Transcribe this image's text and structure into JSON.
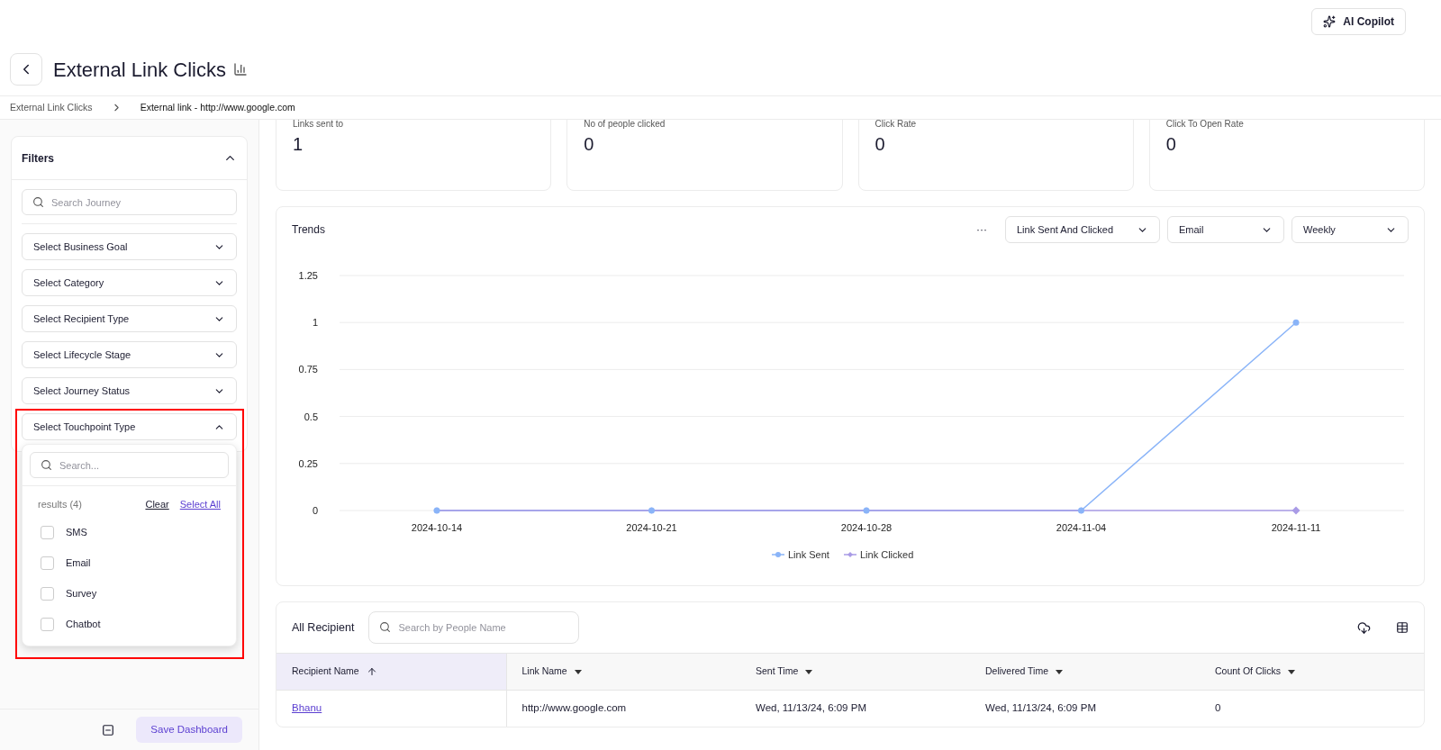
{
  "header": {
    "copilot_button": "AI Copilot",
    "title": "External Link Clicks"
  },
  "breadcrumb": [
    {
      "label": "External Link Clicks",
      "current": false
    },
    {
      "label": "External link - http://www.google.com",
      "current": true
    }
  ],
  "filters": {
    "title": "Filters",
    "expanded": true,
    "search_placeholder": "Search Journey",
    "dropdowns": [
      {
        "label": "Select Business Goal",
        "expanded": false
      },
      {
        "label": "Select Category",
        "expanded": false
      },
      {
        "label": "Select Recipient Type",
        "expanded": false
      },
      {
        "label": "Select Lifecycle Stage",
        "expanded": false
      },
      {
        "label": "Select Journey Status",
        "expanded": false
      },
      {
        "label": "Select Touchpoint Type",
        "expanded": true
      }
    ],
    "popup": {
      "search_placeholder": "Search...",
      "results": "results (4)",
      "clear": "Clear",
      "select_all": "Select All",
      "options": [
        {
          "label": "SMS",
          "checked": false
        },
        {
          "label": "Email",
          "checked": false
        },
        {
          "label": "Survey",
          "checked": false
        },
        {
          "label": "Chatbot",
          "checked": false
        }
      ]
    }
  },
  "save_button": "Save Dashboard",
  "stats": [
    {
      "label": "Links sent to",
      "value": "1"
    },
    {
      "label": "No of people clicked",
      "value": "0"
    },
    {
      "label": "Click Rate",
      "value": "0"
    },
    {
      "label": "Click To Open Rate",
      "value": "0"
    }
  ],
  "trends": {
    "title": "Trends",
    "more": "···",
    "selects": [
      "Link Sent And Clicked",
      "Email",
      "Weekly"
    ],
    "chart_data": {
      "type": "line",
      "x": [
        "2024-10-14",
        "2024-10-21",
        "2024-10-28",
        "2024-11-04",
        "2024-11-11"
      ],
      "series": [
        {
          "name": "Link Sent",
          "color": "#8ab4f8",
          "marker": "circle",
          "values": [
            0,
            0,
            0,
            0,
            1
          ]
        },
        {
          "name": "Link Clicked",
          "color": "#a99be6",
          "marker": "diamond",
          "values": [
            0,
            0,
            0,
            0,
            0
          ]
        }
      ],
      "grid": true,
      "legend": true,
      "ylim": [
        0,
        1.25
      ],
      "yticks": [
        0,
        0.25,
        0.5,
        0.75,
        1,
        1.25
      ]
    }
  },
  "recipients": {
    "title": "All Recipient",
    "search_placeholder": "Search by People Name",
    "columns": [
      {
        "label": "Recipient Name",
        "sorted": true
      },
      {
        "label": "Link Name",
        "sorted": false
      },
      {
        "label": "Sent Time",
        "sorted": false
      },
      {
        "label": "Delivered Time",
        "sorted": false
      },
      {
        "label": "Count Of Clicks",
        "sorted": false
      }
    ],
    "rows": [
      [
        "Bhanu",
        "http://www.google.com",
        "Wed, 11/13/24, 6:09 PM",
        "Wed, 11/13/24, 6:09 PM",
        "0"
      ]
    ]
  }
}
